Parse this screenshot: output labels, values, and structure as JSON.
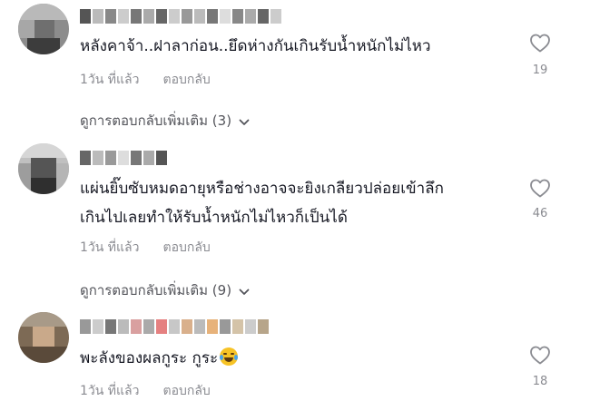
{
  "comments": [
    {
      "text_line1": "หลังคาจ้า..ฝาลาก่อน..ยึดห่างกันเกินรับน้ำหนักไม่ไหว",
      "text_line2": "",
      "time": "1วัน ที่แล้ว",
      "reply_label": "ตอบกลับ",
      "likes": "19",
      "more_replies": "ดูการตอบกลับเพิ่มเติม (3)"
    },
    {
      "text_line1": "แผ่นยิ๊บซับหมดอายุหรือช่างอาจจะยิงเกลียวปล่อยเข้าลึก",
      "text_line2": "เกินไปเลยทำให้รับน้ำหนักไม่ไหวก็เป็นได้",
      "time": "1วัน ที่แล้ว",
      "reply_label": "ตอบกลับ",
      "likes": "46",
      "more_replies": "ดูการตอบกลับเพิ่มเติม (9)"
    },
    {
      "text_line1": "พะลังของผลกูระ กูระ",
      "text_line2": "",
      "emoji": "tears-of-joy-emoji",
      "time": "1วัน ที่แล้ว",
      "reply_label": "ตอบกลับ",
      "likes": "18"
    }
  ],
  "colors": {
    "text": "#161823",
    "muted": "#8a8b91",
    "icon": "#8a8b91"
  }
}
